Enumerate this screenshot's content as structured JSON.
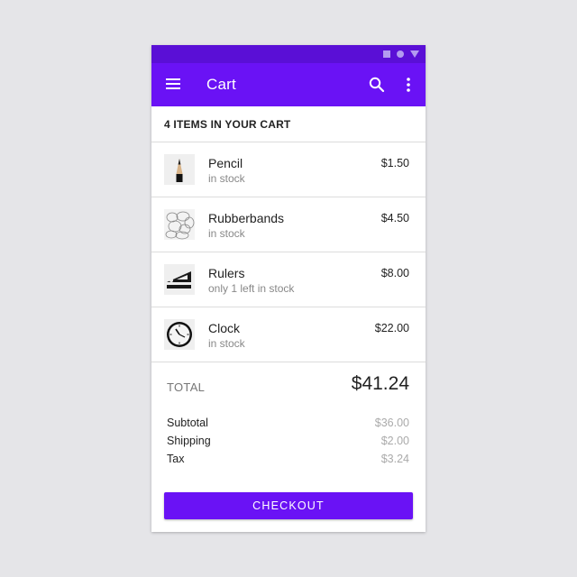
{
  "app_bar": {
    "title": "Cart",
    "menu_icon": "menu-icon",
    "search_icon": "search-icon",
    "more_icon": "more-vert-icon",
    "color": "#6a12f5"
  },
  "status_bar": {
    "color": "#5a0fd6"
  },
  "cart": {
    "header": "4 ITEMS IN YOUR CART",
    "items": [
      {
        "name": "Pencil",
        "stock": "in stock",
        "price": "$1.50",
        "icon": "pencil-icon"
      },
      {
        "name": "Rubberbands",
        "stock": "in stock",
        "price": "$4.50",
        "icon": "rubberbands-icon"
      },
      {
        "name": "Rulers",
        "stock": "only 1 left in stock",
        "price": "$8.00",
        "icon": "rulers-icon"
      },
      {
        "name": "Clock",
        "stock": "in stock",
        "price": "$22.00",
        "icon": "clock-icon"
      }
    ]
  },
  "totals": {
    "total_label": "TOTAL",
    "total_value": "$41.24",
    "subtotal_label": "Subtotal",
    "subtotal_value": "$36.00",
    "shipping_label": "Shipping",
    "shipping_value": "$2.00",
    "tax_label": "Tax",
    "tax_value": "$3.24"
  },
  "checkout": {
    "label": "CHECKOUT"
  }
}
